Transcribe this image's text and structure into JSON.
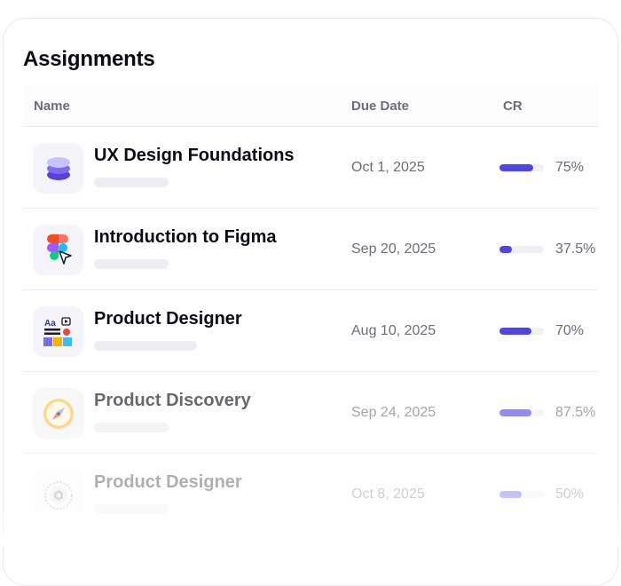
{
  "title": "Assignments",
  "columns": {
    "name": "Name",
    "due": "Due Date",
    "cr": "CR"
  },
  "rows": [
    {
      "name": "UX Design Foundations",
      "due": "Oct 1, 2025",
      "cr": "75%",
      "progress": 0.75,
      "icon": "stack-layers-icon"
    },
    {
      "name": "Introduction to Figma",
      "due": "Sep 20, 2025",
      "cr": "37.5%",
      "progress": 0.28,
      "icon": "figma-logo-icon"
    },
    {
      "name": "Product Designer",
      "due": "Aug 10, 2025",
      "cr": "70%",
      "progress": 0.72,
      "icon": "design-board-icon"
    },
    {
      "name": "Product Discovery",
      "due": "Sep 24, 2025",
      "cr": "87.5%",
      "progress": 0.72,
      "icon": "compass-icon"
    },
    {
      "name": "Product Designer",
      "due": "Oct 8, 2025",
      "cr": "50%",
      "progress": 0.5,
      "icon": "gear-badge-icon"
    }
  ],
  "colors": {
    "accent": "#4f46e5",
    "text": "#0b0b14",
    "muted": "#6e6e78"
  }
}
